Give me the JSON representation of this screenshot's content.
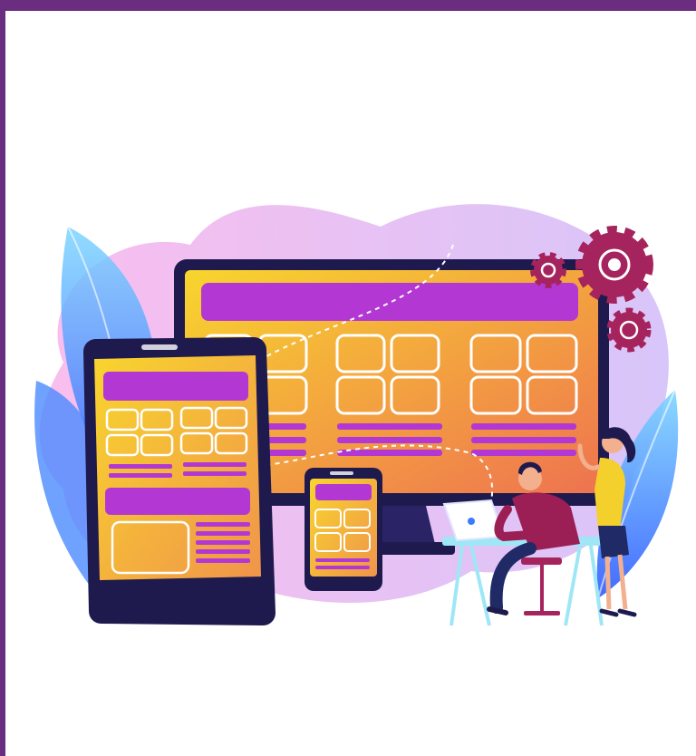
{
  "illustration": {
    "subject": "responsive-web-design",
    "elements": [
      "desktop-monitor",
      "tablet",
      "smartphone",
      "gear-icon",
      "developer",
      "colleague",
      "laptop",
      "desk"
    ]
  },
  "colors": {
    "frame": "#6b2d7f",
    "screen_gradient_start": "#f7d02f",
    "screen_gradient_end": "#ef7a4d",
    "block_purple": "#b338d3",
    "device_body": "#1f1a4e",
    "gear": "#a6245d",
    "blob_pink": "#f3a6e8",
    "blob_lilac": "#d6b6f6",
    "leaf_blue": "#3a7bff",
    "leaf_cyan": "#6ed0ff",
    "desk": "#9fe7f6",
    "shirt_magenta": "#9b1e55",
    "top_yellow": "#f3d02b",
    "pants_navy": "#1f2a66"
  }
}
